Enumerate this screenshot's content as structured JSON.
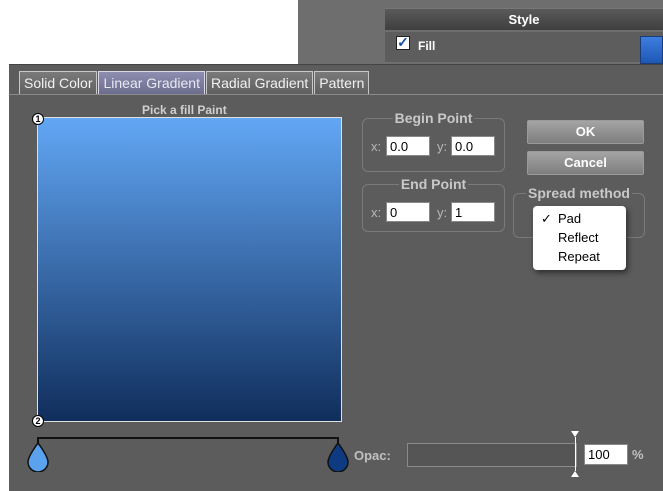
{
  "style_panel": {
    "title": "Style",
    "fill_label": "Fill",
    "fill_checked": true,
    "fill_color": "#2a6ad0"
  },
  "tabs": [
    {
      "label": "Solid Color",
      "active": false
    },
    {
      "label": "Linear Gradient",
      "active": true
    },
    {
      "label": "Radial Gradient",
      "active": false
    },
    {
      "label": "Pattern",
      "active": false
    }
  ],
  "preview": {
    "title": "Pick a fill Paint",
    "point1_label": "1",
    "point2_label": "2",
    "start_color": "#62a7f5",
    "end_color": "#102e5c"
  },
  "begin_point": {
    "title": "Begin Point",
    "x_label": "x:",
    "x_value": "0.0",
    "y_label": "y:",
    "y_value": "0.0"
  },
  "end_point": {
    "title": "End Point",
    "x_label": "x:",
    "x_value": "0",
    "y_label": "y:",
    "y_value": "1"
  },
  "buttons": {
    "ok": "OK",
    "cancel": "Cancel"
  },
  "spread_method": {
    "title": "Spread method",
    "options": [
      {
        "label": "Pad",
        "selected": true
      },
      {
        "label": "Reflect",
        "selected": false
      },
      {
        "label": "Repeat",
        "selected": false
      }
    ],
    "check_mark": "✓"
  },
  "opacity": {
    "label": "Opac:",
    "value": "100",
    "unit": "%"
  },
  "stops": {
    "left_color": "#5aa2ee",
    "right_color": "#0d3a80"
  }
}
